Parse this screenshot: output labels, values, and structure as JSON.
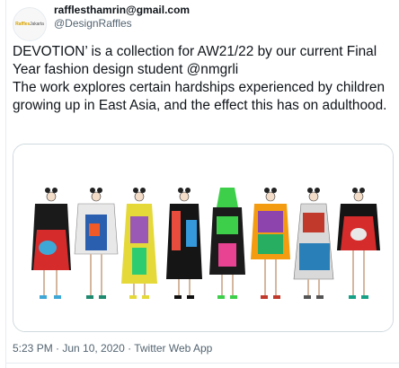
{
  "tweet": {
    "author": {
      "display_name": "raffles­thamrin@gmail.com",
      "handle": "@DesignRaffles",
      "avatar_text": "Raffles",
      "avatar_sub": "Jakarta"
    },
    "text_lines": [
      "DEVOTION’ is a collection for AW21/22 by our current Final Year fashion design student @nmgrli",
      "The work explores certain hardships experienced by children growing up in East Asia, and the effect this has on adulthood."
    ],
    "timestamp": "5:23 PM · Jun 10, 2020 · Twitter Web App",
    "media_alt": "fashion illustration"
  },
  "colors": {
    "text": "#0f1419",
    "secondary": "#536471",
    "border": "#cfd9de"
  }
}
